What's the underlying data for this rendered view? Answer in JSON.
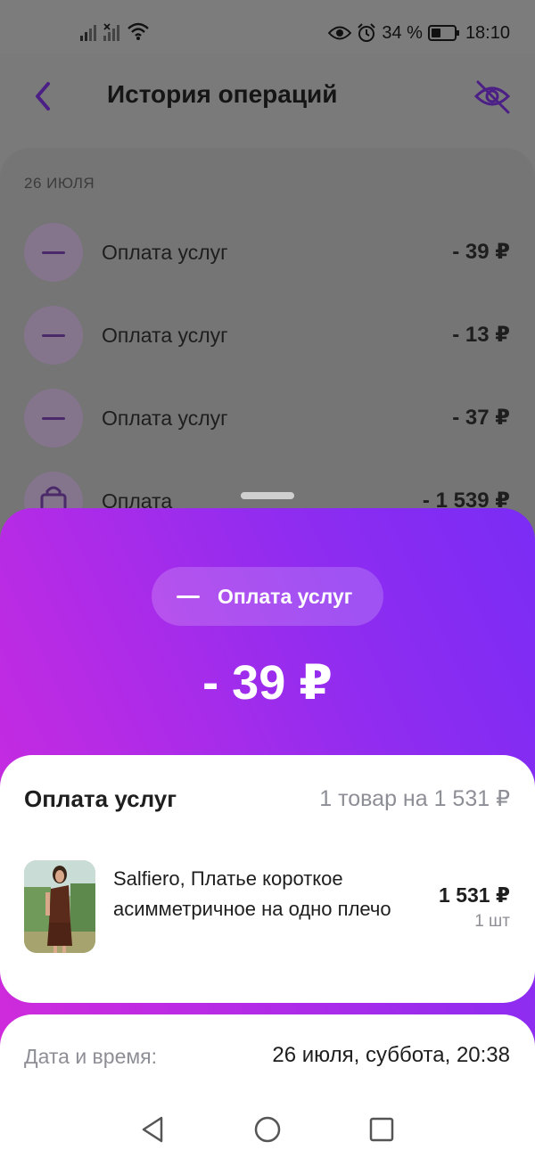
{
  "status_bar": {
    "battery": "34 %",
    "time": "18:10"
  },
  "header": {
    "title": "История операций"
  },
  "list": {
    "date": "26 ИЮЛЯ",
    "items": [
      {
        "name": "Оплата услуг",
        "amount": "- 39 ₽",
        "icon": "minus-icon"
      },
      {
        "name": "Оплата услуг",
        "amount": "- 13 ₽",
        "icon": "minus-icon"
      },
      {
        "name": "Оплата услуг",
        "amount": "- 37 ₽",
        "icon": "minus-icon"
      },
      {
        "name": "Оплата",
        "amount": "- 1 539 ₽",
        "icon": "shopping-bag-icon"
      }
    ]
  },
  "detail": {
    "category": "Оплата услуг",
    "amount": "- 39 ₽",
    "card_title": "Оплата услуг",
    "summary": "1 товар на 1 531 ₽",
    "product": {
      "name": "Salfiero, Платье короткое асимметричное на одно плечо",
      "price": "1 531 ₽",
      "qty": "1 шт"
    }
  },
  "info": {
    "label": "Дата и время:",
    "value": "26 июля, суббота, 20:38"
  },
  "colors": {
    "accent": "#7a2cf5",
    "gradient_start": "#d52bd9"
  }
}
